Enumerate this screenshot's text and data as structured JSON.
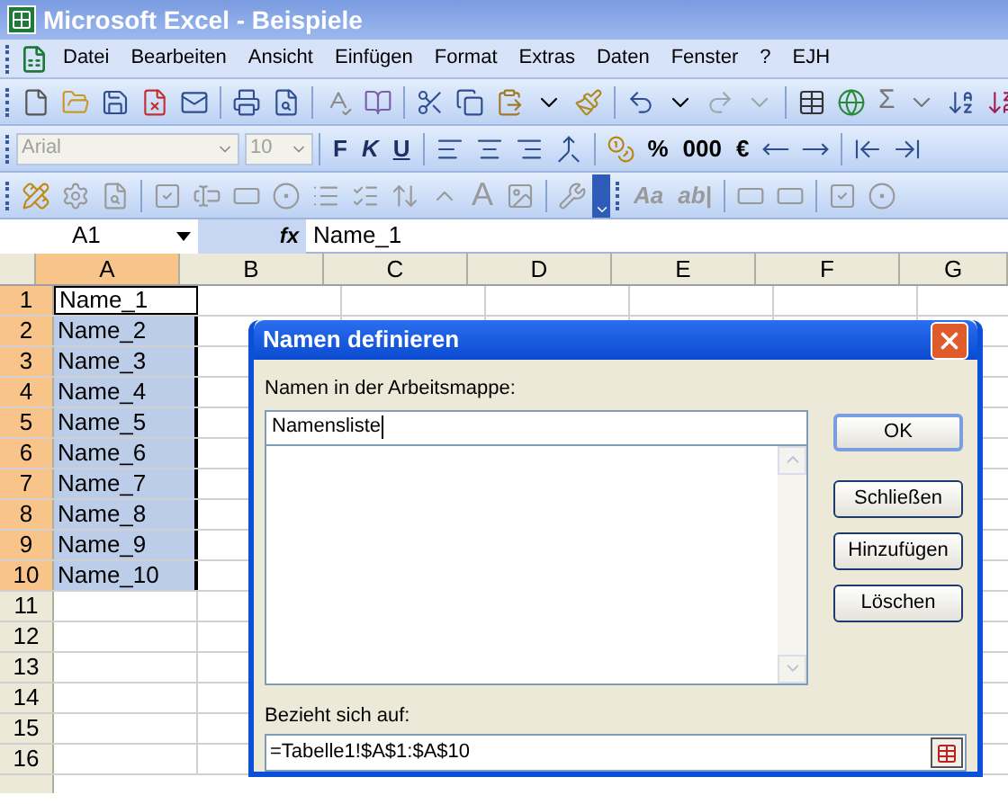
{
  "window": {
    "title": "Microsoft Excel - Beispiele"
  },
  "menu": [
    "Datei",
    "Bearbeiten",
    "Ansicht",
    "Einfügen",
    "Format",
    "Extras",
    "Daten",
    "Fenster",
    "?",
    "EJH"
  ],
  "standard_toolbar": {
    "texts": [
      "Σ"
    ]
  },
  "format_toolbar": {
    "font": {
      "value": "Arial",
      "disabled": true
    },
    "size": {
      "value": "10",
      "disabled": true
    },
    "texts": [
      "F",
      "K",
      "U",
      "%",
      "000",
      "€"
    ]
  },
  "forms_toolbar": {
    "texts": [
      "A",
      "Aa",
      "ab|"
    ]
  },
  "formula_bar": {
    "name_box": "A1",
    "fx": "fx",
    "value": "Name_1"
  },
  "columns": [
    {
      "label": "A",
      "selected": true
    },
    {
      "label": "B",
      "selected": false
    },
    {
      "label": "C",
      "selected": false
    },
    {
      "label": "D",
      "selected": false
    },
    {
      "label": "E",
      "selected": false
    },
    {
      "label": "F",
      "selected": false
    },
    {
      "label": "G",
      "selected": false
    }
  ],
  "rows": [
    {
      "header": "1",
      "cell_a": "Name_1",
      "selected": true,
      "active": true
    },
    {
      "header": "2",
      "cell_a": "Name_2",
      "selected": true,
      "active": false
    },
    {
      "header": "3",
      "cell_a": "Name_3",
      "selected": true,
      "active": false
    },
    {
      "header": "4",
      "cell_a": "Name_4",
      "selected": true,
      "active": false
    },
    {
      "header": "5",
      "cell_a": "Name_5",
      "selected": true,
      "active": false
    },
    {
      "header": "6",
      "cell_a": "Name_6",
      "selected": true,
      "active": false
    },
    {
      "header": "7",
      "cell_a": "Name_7",
      "selected": true,
      "active": false
    },
    {
      "header": "8",
      "cell_a": "Name_8",
      "selected": true,
      "active": false
    },
    {
      "header": "9",
      "cell_a": "Name_9",
      "selected": true,
      "active": false
    },
    {
      "header": "10",
      "cell_a": "Name_10",
      "selected": true,
      "active": false
    },
    {
      "header": "11",
      "selected": false,
      "active": false
    },
    {
      "header": "12",
      "selected": false,
      "active": false
    },
    {
      "header": "13",
      "selected": false,
      "active": false
    },
    {
      "header": "14",
      "selected": false,
      "active": false
    },
    {
      "header": "15",
      "selected": false,
      "active": false
    },
    {
      "header": "16",
      "selected": false,
      "active": false
    }
  ],
  "dialog": {
    "title": "Namen definieren",
    "names_label": "Namen in der Arbeitsmappe:",
    "name_value": "Namensliste",
    "refers_label": "Bezieht sich auf:",
    "refers_value": "=Tabelle1!$A$1:$A$10",
    "buttons": [
      {
        "label": "OK",
        "default": true
      },
      {
        "label": "Schließen",
        "default": false
      },
      {
        "label": "Hinzufügen",
        "default": false
      },
      {
        "label": "Löschen",
        "default": false
      }
    ]
  }
}
